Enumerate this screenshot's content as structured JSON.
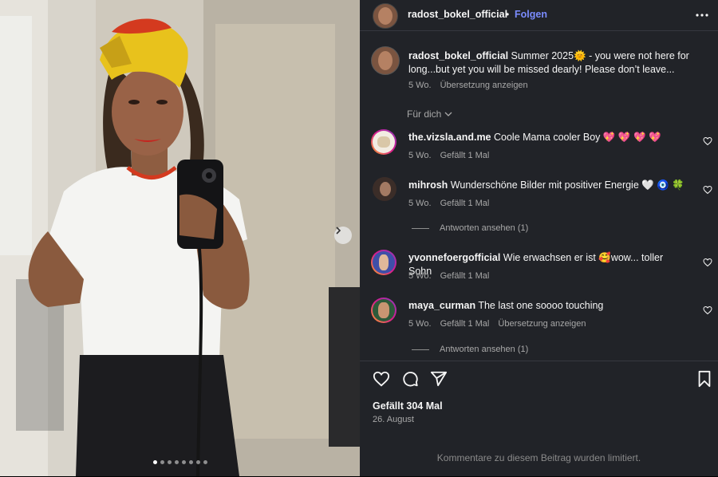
{
  "post": {
    "username": "radost_bokel_official",
    "follow_label": "Folgen",
    "separator": "•",
    "caption": {
      "username": "radost_bokel_official",
      "text": "Summer 2025🌞 - you were not here for long...but yet you will be missed dearly! Please don’t leave...",
      "time": "5 Wo.",
      "translate": "Übersetzung anzeigen"
    },
    "filter_label": "Für dich",
    "carousel_dot_count": 8,
    "carousel_active_index": 0
  },
  "comments": [
    {
      "username": "the.vizsla.and.me",
      "text": "Coole Mama cooler Boy 💖 💖 💖 💖",
      "time": "5 Wo.",
      "likes": "Gefällt 1 Mal",
      "translate": "",
      "replies": ""
    },
    {
      "username": "mihrosh",
      "text": "Wunderschöne Bilder mit positiver Energie 🤍 🧿 🍀",
      "time": "5 Wo.",
      "likes": "Gefällt 1 Mal",
      "translate": "",
      "replies": "Antworten ansehen (1)"
    },
    {
      "username": "yvonnefoergofficial",
      "text": "Wie erwachsen er ist 🥰wow... toller Sohn",
      "time": "5 Wo.",
      "likes": "Gefällt 1 Mal",
      "translate": "",
      "replies": ""
    },
    {
      "username": "maya_curman",
      "text": "The last one soooo touching",
      "time": "5 Wo.",
      "likes": "Gefällt 1 Mal",
      "translate": "Übersetzung anzeigen",
      "replies": "Antworten ansehen (1)"
    }
  ],
  "footer": {
    "likes": "Gefällt 304 Mal",
    "date": "26. August",
    "limited_notice": "Kommentare zu diesem Beitrag wurden limitiert."
  },
  "colors": {
    "panel_bg": "#212328",
    "link_blue": "#7b8cff",
    "muted": "#a8a8a8"
  },
  "icons": [
    "more-icon",
    "chevron-down-icon",
    "heart-icon",
    "comment-icon",
    "share-icon",
    "bookmark-icon",
    "chevron-right-icon"
  ]
}
